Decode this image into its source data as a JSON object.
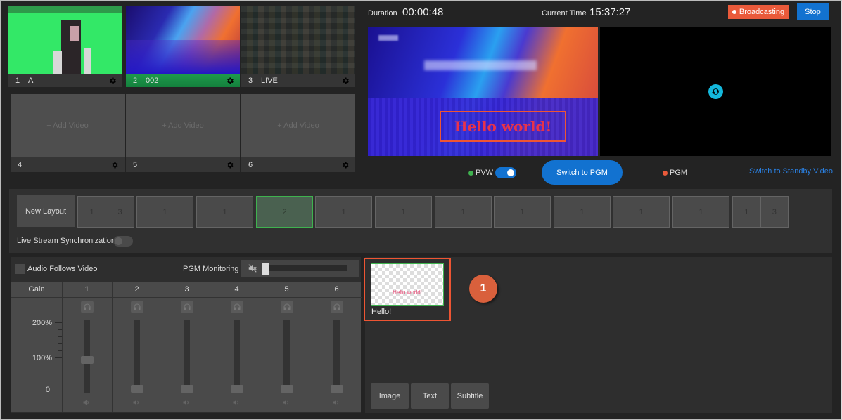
{
  "sources": [
    {
      "num": "1",
      "name": "A",
      "active": false,
      "thumb": "green-screen-person"
    },
    {
      "num": "2",
      "name": "002",
      "active": true,
      "thumb": "blue-abstract"
    },
    {
      "num": "3",
      "name": "LIVE",
      "active": false,
      "thumb": "live-feed"
    },
    {
      "num": "4",
      "name": "",
      "placeholder": "+ Add Video"
    },
    {
      "num": "5",
      "name": "",
      "placeholder": "+ Add Video"
    },
    {
      "num": "6",
      "name": "",
      "placeholder": "+ Add Video"
    }
  ],
  "header": {
    "duration_label": "Duration",
    "duration_value": "00:00:48",
    "current_time_label": "Current Time",
    "current_time_value": "15:37:27",
    "broadcasting_label": "Broadcasting",
    "stop_label": "Stop"
  },
  "preview": {
    "overlay_text": "Hello world!",
    "pvw_label": "PVW",
    "pvw_toggle_on": true,
    "switch_label": "Switch to PGM",
    "pgm_label": "PGM",
    "standby_link": "Switch to Standby Video"
  },
  "colors": {
    "pvw_dot": "#3fb24f",
    "pgm_dot": "#ea5a3a",
    "accent": "#1272d0",
    "broadcast": "#ea5a3a"
  },
  "layouts": {
    "new_layout_label": "New Layout",
    "items": [
      {
        "cells": [
          "1",
          "3"
        ],
        "active": false
      },
      {
        "cells": [
          "1"
        ],
        "active": false
      },
      {
        "cells": [
          "1"
        ],
        "active": false
      },
      {
        "cells": [
          "2"
        ],
        "active": true
      },
      {
        "cells": [
          "1"
        ],
        "active": false
      },
      {
        "cells": [
          "1"
        ],
        "active": false
      },
      {
        "cells": [
          "1"
        ],
        "active": false
      },
      {
        "cells": [
          "1"
        ],
        "active": false
      },
      {
        "cells": [
          "1"
        ],
        "active": false
      },
      {
        "cells": [
          "1"
        ],
        "active": false
      },
      {
        "cells": [
          "1"
        ],
        "active": false
      },
      {
        "cells": [
          "1",
          "3"
        ],
        "active": false
      }
    ],
    "sync_label": "Live Stream Synchronization",
    "sync_on": false
  },
  "audio": {
    "follows_video_label": "Audio Follows Video",
    "follows_video_checked": false,
    "pgm_monitoring_label": "PGM Monitoring",
    "pgm_monitoring_level": 0,
    "gain_header": "Gain",
    "gain_labels": [
      "200%",
      "100%",
      "0"
    ],
    "channels": [
      {
        "label": "1",
        "gain_percent": 100
      },
      {
        "label": "2",
        "gain_percent": 0
      },
      {
        "label": "3",
        "gain_percent": 0
      },
      {
        "label": "4",
        "gain_percent": 0
      },
      {
        "label": "5",
        "gain_percent": 0
      },
      {
        "label": "6",
        "gain_percent": 0
      }
    ]
  },
  "overlays": {
    "items": [
      {
        "name": "Hello!",
        "preview_text": "Hello world!"
      }
    ],
    "badge": "1",
    "buttons": [
      "Image",
      "Text",
      "Subtitle"
    ]
  }
}
